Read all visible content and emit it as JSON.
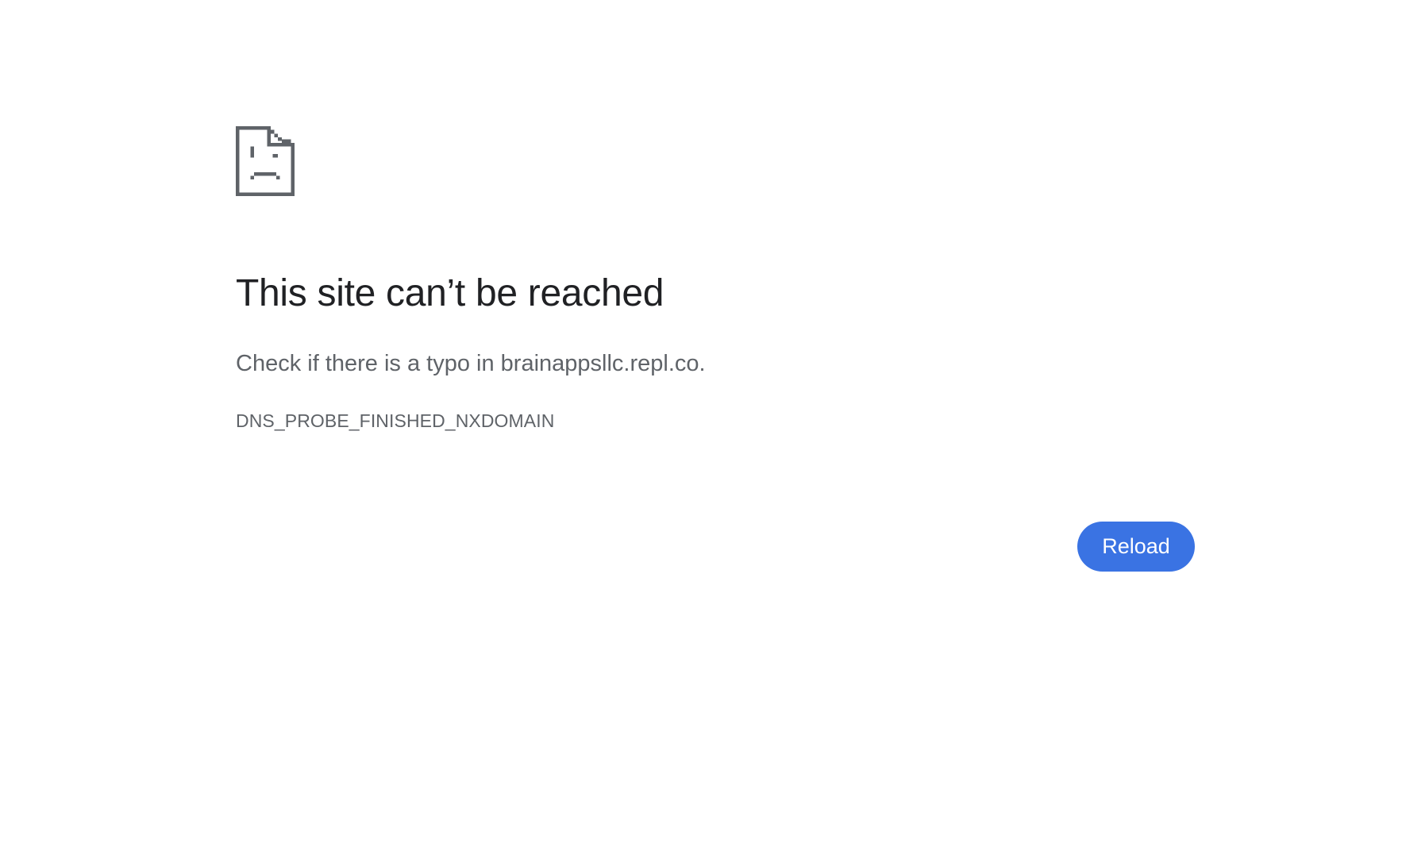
{
  "error_page": {
    "icon": "sad-page-icon",
    "headline": "This site can’t be reached",
    "suggestion": "Check if there is a typo in brainappsllc.repl.co.",
    "error_code": "DNS_PROBE_FINISHED_NXDOMAIN",
    "reload_label": "Reload"
  },
  "colors": {
    "background": "#ffffff",
    "headline": "#202124",
    "secondary_text": "#5f6368",
    "icon": "#5f6368",
    "button_bg": "#3a73e3",
    "button_text": "#ffffff"
  }
}
